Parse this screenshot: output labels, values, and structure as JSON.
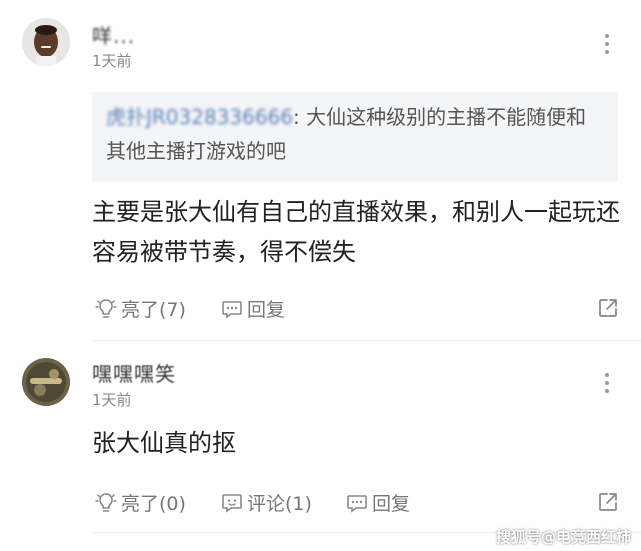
{
  "comments": [
    {
      "username": "咩...",
      "time": "1天前",
      "quote": {
        "name": "虎扑JR0328336666",
        "text": ": 大仙这种级别的主播不能随便和其他主播打游戏的吧"
      },
      "content": "主要是张大仙有自己的直播效果，和别人一起玩还容易被带节奏，得不偿失",
      "actions": {
        "like": "亮了(7)",
        "reply": "回复"
      }
    },
    {
      "username": "嘿嘿嘿笑",
      "time": "1天前",
      "content": "张大仙真的抠",
      "actions": {
        "like": "亮了(0)",
        "comment": "评论(1)",
        "reply": "回复"
      }
    }
  ],
  "watermark": "搜狐号@电竞西红柿",
  "colors": {
    "quote_name": "#5b7fb8",
    "quote_bg": "#f4f5f7",
    "secondary_text": "#8a8a8a"
  }
}
